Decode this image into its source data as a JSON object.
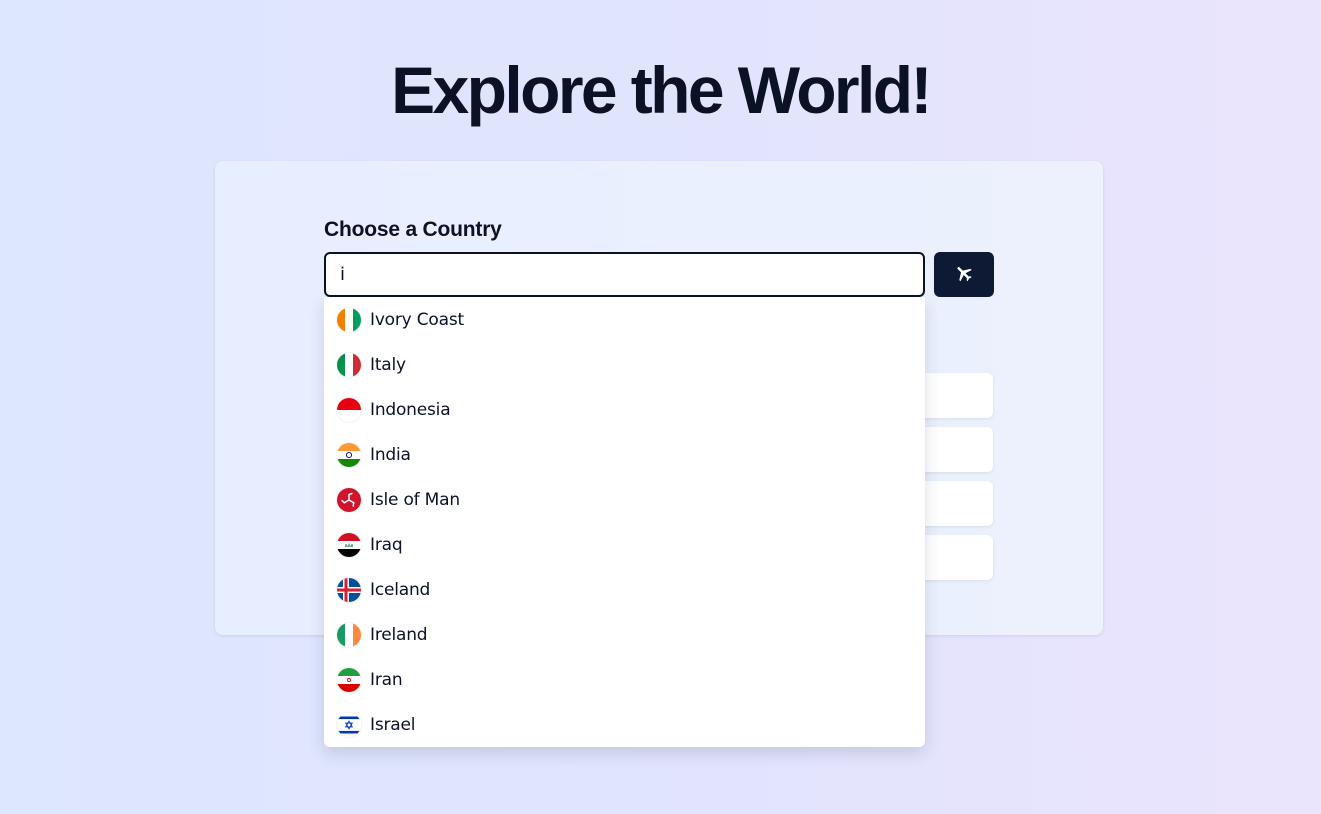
{
  "header": {
    "title": "Explore the World!"
  },
  "form": {
    "label": "Choose a Country",
    "input_value": "i",
    "submit_icon": "airplane-icon"
  },
  "dropdown": {
    "options": [
      {
        "label": "Ivory Coast",
        "flag": "ivory-coast-flag-icon"
      },
      {
        "label": "Italy",
        "flag": "italy-flag-icon"
      },
      {
        "label": "Indonesia",
        "flag": "indonesia-flag-icon"
      },
      {
        "label": "India",
        "flag": "india-flag-icon"
      },
      {
        "label": "Isle of Man",
        "flag": "isle-of-man-flag-icon"
      },
      {
        "label": "Iraq",
        "flag": "iraq-flag-icon"
      },
      {
        "label": "Iceland",
        "flag": "iceland-flag-icon"
      },
      {
        "label": "Ireland",
        "flag": "ireland-flag-icon"
      },
      {
        "label": "Iran",
        "flag": "iran-flag-icon"
      },
      {
        "label": "Israel",
        "flag": "israel-flag-icon"
      }
    ]
  },
  "colors": {
    "text": "#0b1226",
    "button_bg": "#0e1a33",
    "card_bg": "#e7eeff"
  }
}
